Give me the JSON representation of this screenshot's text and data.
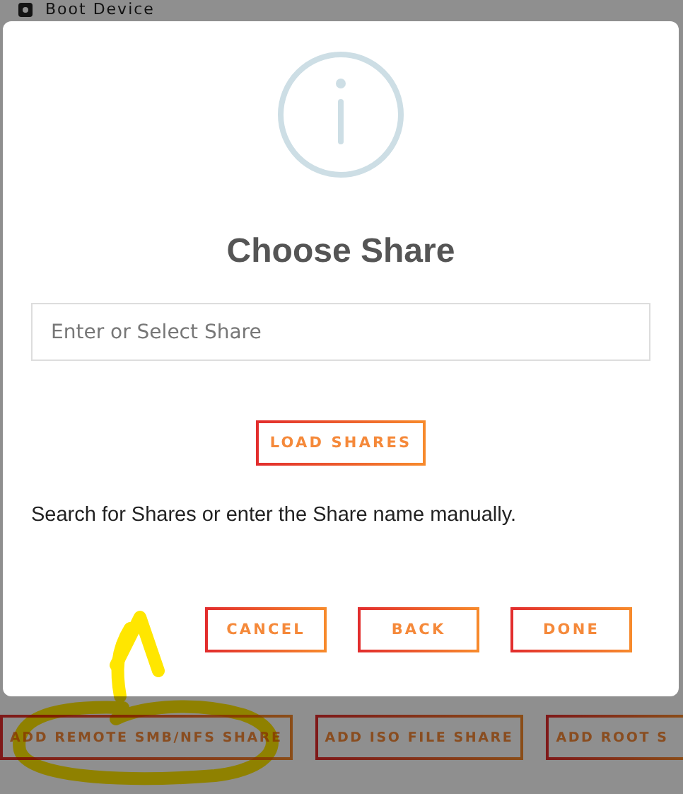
{
  "background": {
    "heading": "Boot Device",
    "buttons": [
      {
        "label": "ADD REMOTE SMB/NFS SHARE"
      },
      {
        "label": "ADD ISO FILE SHARE"
      },
      {
        "label": "ADD ROOT S"
      }
    ]
  },
  "dialog": {
    "title": "Choose Share",
    "field": {
      "placeholder": "Enter or Select Share"
    },
    "load_button": "LOAD SHARES",
    "hint": "Search for Shares or enter the Share name manually.",
    "buttons": [
      "CANCEL",
      "BACK",
      "DONE"
    ]
  }
}
